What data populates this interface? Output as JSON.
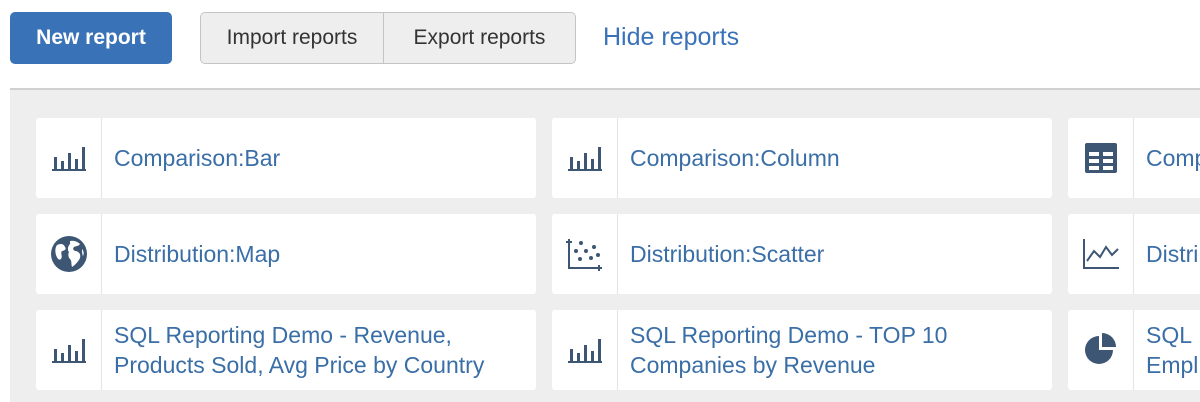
{
  "toolbar": {
    "new_report_label": "New report",
    "import_label": "Import reports",
    "export_label": "Export reports",
    "hide_label": "Hide reports"
  },
  "reports": [
    {
      "title": "Comparison:Bar",
      "icon": "bar-chart-icon"
    },
    {
      "title": "Comparison:Column",
      "icon": "column-chart-icon"
    },
    {
      "title": "Comp",
      "icon": "table-icon"
    },
    {
      "title": "Distribution:Map",
      "icon": "globe-icon"
    },
    {
      "title": "Distribution:Scatter",
      "icon": "scatter-chart-icon"
    },
    {
      "title": "Distri",
      "icon": "line-chart-icon"
    },
    {
      "title_line1": "SQL Reporting Demo - Revenue,",
      "title_line2": "Products Sold, Avg Price by Country",
      "icon": "bar-chart-icon"
    },
    {
      "title_line1": "SQL Reporting Demo - TOP 10",
      "title_line2": "Companies by Revenue",
      "icon": "bar-chart-icon"
    },
    {
      "title_line1": "SQL",
      "title_line2": "Empl",
      "icon": "pie-chart-icon"
    }
  ],
  "colors": {
    "primary": "#3a72b8",
    "link": "#3a6ea6",
    "icon": "#3d5673",
    "panel_bg": "#eeeeee"
  }
}
